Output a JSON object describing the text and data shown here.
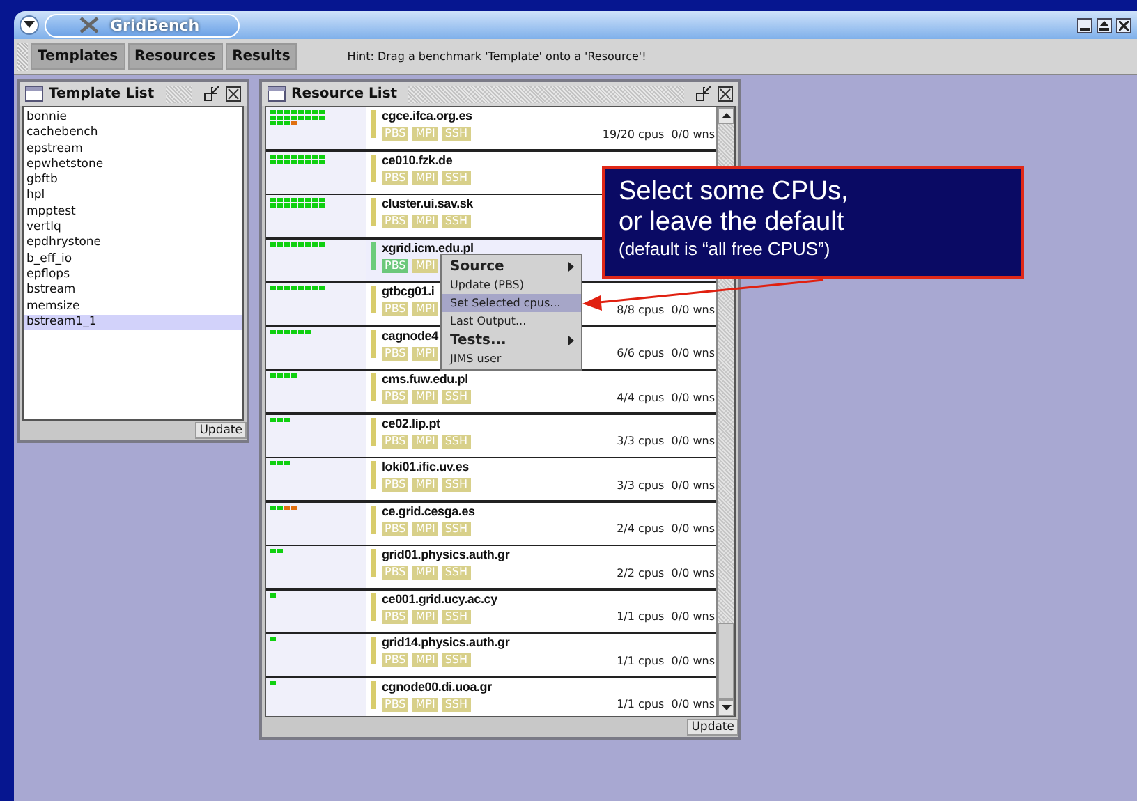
{
  "window": {
    "title": "GridBench"
  },
  "toolbar": {
    "buttons": [
      "Templates",
      "Resources",
      "Results"
    ],
    "hint": "Hint: Drag a benchmark 'Template' onto a 'Resource'!"
  },
  "template_list": {
    "title": "Template List",
    "update_button": "Update",
    "items": [
      {
        "label": "bonnie",
        "selected": false
      },
      {
        "label": "cachebench",
        "selected": false
      },
      {
        "label": "epstream",
        "selected": false
      },
      {
        "label": "epwhetstone",
        "selected": false
      },
      {
        "label": "gbftb",
        "selected": false
      },
      {
        "label": "hpl",
        "selected": false
      },
      {
        "label": "mpptest",
        "selected": false
      },
      {
        "label": "vertlq",
        "selected": false
      },
      {
        "label": "epdhrystone",
        "selected": false
      },
      {
        "label": "b_eff_io",
        "selected": false
      },
      {
        "label": "epflops",
        "selected": false
      },
      {
        "label": "bstream",
        "selected": false
      },
      {
        "label": "memsize",
        "selected": false
      },
      {
        "label": "bstream1_1",
        "selected": true
      }
    ]
  },
  "resource_list": {
    "title": "Resource List",
    "update_button": "Update",
    "rows": [
      {
        "host": "cgce.ifca.org.es",
        "selected": false,
        "reading": "19/20 cpus  0/0 wns",
        "slots": [
          {
            "color": "#10d010"
          },
          {
            "color": "#10d010"
          },
          {
            "color": "#10d010"
          },
          {
            "color": "#10d010"
          },
          {
            "color": "#10d010"
          },
          {
            "color": "#10d010"
          },
          {
            "color": "#10d010"
          },
          {
            "color": "#10d010"
          },
          {
            "color": "#10d010"
          },
          {
            "color": "#10d010"
          },
          {
            "color": "#10d010"
          },
          {
            "color": "#10d010"
          },
          {
            "color": "#10d010"
          },
          {
            "color": "#10d010"
          },
          {
            "color": "#10d010"
          },
          {
            "color": "#10d010"
          },
          {
            "color": "#10d010"
          },
          {
            "color": "#10d010"
          },
          {
            "color": "#10d010"
          },
          {
            "color": "#e07010"
          }
        ],
        "tags": [
          {
            "label": "PBS",
            "selected": false
          },
          {
            "label": "MPI",
            "selected": false
          },
          {
            "label": "SSH",
            "selected": false
          }
        ]
      },
      {
        "host": "ce010.fzk.de",
        "selected": false,
        "slots": [
          {
            "color": "#10d010"
          },
          {
            "color": "#10d010"
          },
          {
            "color": "#10d010"
          },
          {
            "color": "#10d010"
          },
          {
            "color": "#10d010"
          },
          {
            "color": "#10d010"
          },
          {
            "color": "#10d010"
          },
          {
            "color": "#10d010"
          },
          {
            "color": "#10d010"
          },
          {
            "color": "#10d010"
          },
          {
            "color": "#10d010"
          },
          {
            "color": "#10d010"
          },
          {
            "color": "#10d010"
          },
          {
            "color": "#10d010"
          },
          {
            "color": "#10d010"
          },
          {
            "color": "#10d010"
          }
        ],
        "tags": [
          {
            "label": "PBS",
            "selected": false
          },
          {
            "label": "MPI",
            "selected": false
          },
          {
            "label": "SSH",
            "selected": false
          }
        ]
      },
      {
        "host": "cluster.ui.sav.sk",
        "selected": false,
        "slots": [
          {
            "color": "#10d010"
          },
          {
            "color": "#10d010"
          },
          {
            "color": "#10d010"
          },
          {
            "color": "#10d010"
          },
          {
            "color": "#10d010"
          },
          {
            "color": "#10d010"
          },
          {
            "color": "#10d010"
          },
          {
            "color": "#10d010"
          },
          {
            "color": "#10d010"
          },
          {
            "color": "#10d010"
          },
          {
            "color": "#10d010"
          },
          {
            "color": "#10d010"
          },
          {
            "color": "#10d010"
          },
          {
            "color": "#10d010"
          },
          {
            "color": "#10d010"
          },
          {
            "color": "#10d010"
          }
        ],
        "tags": [
          {
            "label": "PBS",
            "selected": false
          },
          {
            "label": "MPI",
            "selected": false
          },
          {
            "label": "SSH",
            "selected": false
          }
        ]
      },
      {
        "host": "xgrid.icm.edu.pl",
        "selected": true,
        "slots": [
          {
            "color": "#10d010"
          },
          {
            "color": "#10d010"
          },
          {
            "color": "#10d010"
          },
          {
            "color": "#10d010"
          },
          {
            "color": "#10d010"
          },
          {
            "color": "#10d010"
          },
          {
            "color": "#10d010"
          },
          {
            "color": "#10d010"
          }
        ],
        "tags": [
          {
            "label": "PBS",
            "selected": true
          },
          {
            "label": "MPI",
            "selected": false
          }
        ]
      },
      {
        "host": "gtbcg01.i",
        "selected": false,
        "reading": "8/8 cpus  0/0 wns",
        "slots": [
          {
            "color": "#10d010"
          },
          {
            "color": "#10d010"
          },
          {
            "color": "#10d010"
          },
          {
            "color": "#10d010"
          },
          {
            "color": "#10d010"
          },
          {
            "color": "#10d010"
          },
          {
            "color": "#10d010"
          },
          {
            "color": "#10d010"
          }
        ],
        "tags": [
          {
            "label": "PBS",
            "selected": false
          },
          {
            "label": "MPI",
            "selected": false
          }
        ]
      },
      {
        "host": "cagnode4",
        "selected": false,
        "reading": "6/6 cpus  0/0 wns",
        "slots": [
          {
            "color": "#10d010"
          },
          {
            "color": "#10d010"
          },
          {
            "color": "#10d010"
          },
          {
            "color": "#10d010"
          },
          {
            "color": "#10d010"
          },
          {
            "color": "#10d010"
          }
        ],
        "tags": [
          {
            "label": "PBS",
            "selected": false
          },
          {
            "label": "MPI",
            "selected": false
          }
        ]
      },
      {
        "host": "cms.fuw.edu.pl",
        "selected": false,
        "reading": "4/4 cpus  0/0 wns",
        "slots": [
          {
            "color": "#10d010"
          },
          {
            "color": "#10d010"
          },
          {
            "color": "#10d010"
          },
          {
            "color": "#10d010"
          }
        ],
        "tags": [
          {
            "label": "PBS",
            "selected": false
          },
          {
            "label": "MPI",
            "selected": false
          },
          {
            "label": "SSH",
            "selected": false
          }
        ]
      },
      {
        "host": "ce02.lip.pt",
        "selected": false,
        "reading": "3/3 cpus  0/0 wns",
        "slots": [
          {
            "color": "#10d010"
          },
          {
            "color": "#10d010"
          },
          {
            "color": "#10d010"
          }
        ],
        "tags": [
          {
            "label": "PBS",
            "selected": false
          },
          {
            "label": "MPI",
            "selected": false
          },
          {
            "label": "SSH",
            "selected": false
          }
        ]
      },
      {
        "host": "loki01.ific.uv.es",
        "selected": false,
        "reading": "3/3 cpus  0/0 wns",
        "slots": [
          {
            "color": "#10d010"
          },
          {
            "color": "#10d010"
          },
          {
            "color": "#10d010"
          }
        ],
        "tags": [
          {
            "label": "PBS",
            "selected": false
          },
          {
            "label": "MPI",
            "selected": false
          },
          {
            "label": "SSH",
            "selected": false
          }
        ]
      },
      {
        "host": "ce.grid.cesga.es",
        "selected": false,
        "reading": "2/4 cpus  0/0 wns",
        "slots": [
          {
            "color": "#10d010"
          },
          {
            "color": "#10d010"
          },
          {
            "color": "#e07010"
          },
          {
            "color": "#e07010"
          }
        ],
        "tags": [
          {
            "label": "PBS",
            "selected": false
          },
          {
            "label": "MPI",
            "selected": false
          },
          {
            "label": "SSH",
            "selected": false
          }
        ]
      },
      {
        "host": "grid01.physics.auth.gr",
        "selected": false,
        "reading": "2/2 cpus  0/0 wns",
        "slots": [
          {
            "color": "#10d010"
          },
          {
            "color": "#10d010"
          }
        ],
        "tags": [
          {
            "label": "PBS",
            "selected": false
          },
          {
            "label": "MPI",
            "selected": false
          },
          {
            "label": "SSH",
            "selected": false
          }
        ]
      },
      {
        "host": "ce001.grid.ucy.ac.cy",
        "selected": false,
        "reading": "1/1 cpus  0/0 wns",
        "slots": [
          {
            "color": "#10d010"
          }
        ],
        "tags": [
          {
            "label": "PBS",
            "selected": false
          },
          {
            "label": "MPI",
            "selected": false
          },
          {
            "label": "SSH",
            "selected": false
          }
        ]
      },
      {
        "host": "grid14.physics.auth.gr",
        "selected": false,
        "reading": "1/1 cpus  0/0 wns",
        "slots": [
          {
            "color": "#10d010"
          }
        ],
        "tags": [
          {
            "label": "PBS",
            "selected": false
          },
          {
            "label": "MPI",
            "selected": false
          },
          {
            "label": "SSH",
            "selected": false
          }
        ]
      },
      {
        "host": "cgnode00.di.uoa.gr",
        "selected": false,
        "reading": "1/1 cpus  0/0 wns",
        "slots": [
          {
            "color": "#10d010"
          }
        ],
        "tags": [
          {
            "label": "PBS",
            "selected": false
          },
          {
            "label": "MPI",
            "selected": false
          },
          {
            "label": "SSH",
            "selected": false
          }
        ]
      }
    ]
  },
  "context_menu": {
    "items": [
      {
        "label": "Source",
        "kind": "submenu",
        "selected": false
      },
      {
        "label": "Update (PBS)",
        "kind": "item",
        "selected": false
      },
      {
        "label": "Set Selected cpus...",
        "kind": "item",
        "selected": true
      },
      {
        "label": "Last Output...",
        "kind": "item",
        "selected": false
      },
      {
        "label": "Tests...",
        "kind": "submenu",
        "selected": false
      },
      {
        "label": "JIMS user",
        "kind": "item",
        "selected": false
      }
    ]
  },
  "callout": {
    "lines": [
      "Select some CPUs,",
      "or leave the default"
    ],
    "note": "(default is “all free CPUS”)"
  }
}
